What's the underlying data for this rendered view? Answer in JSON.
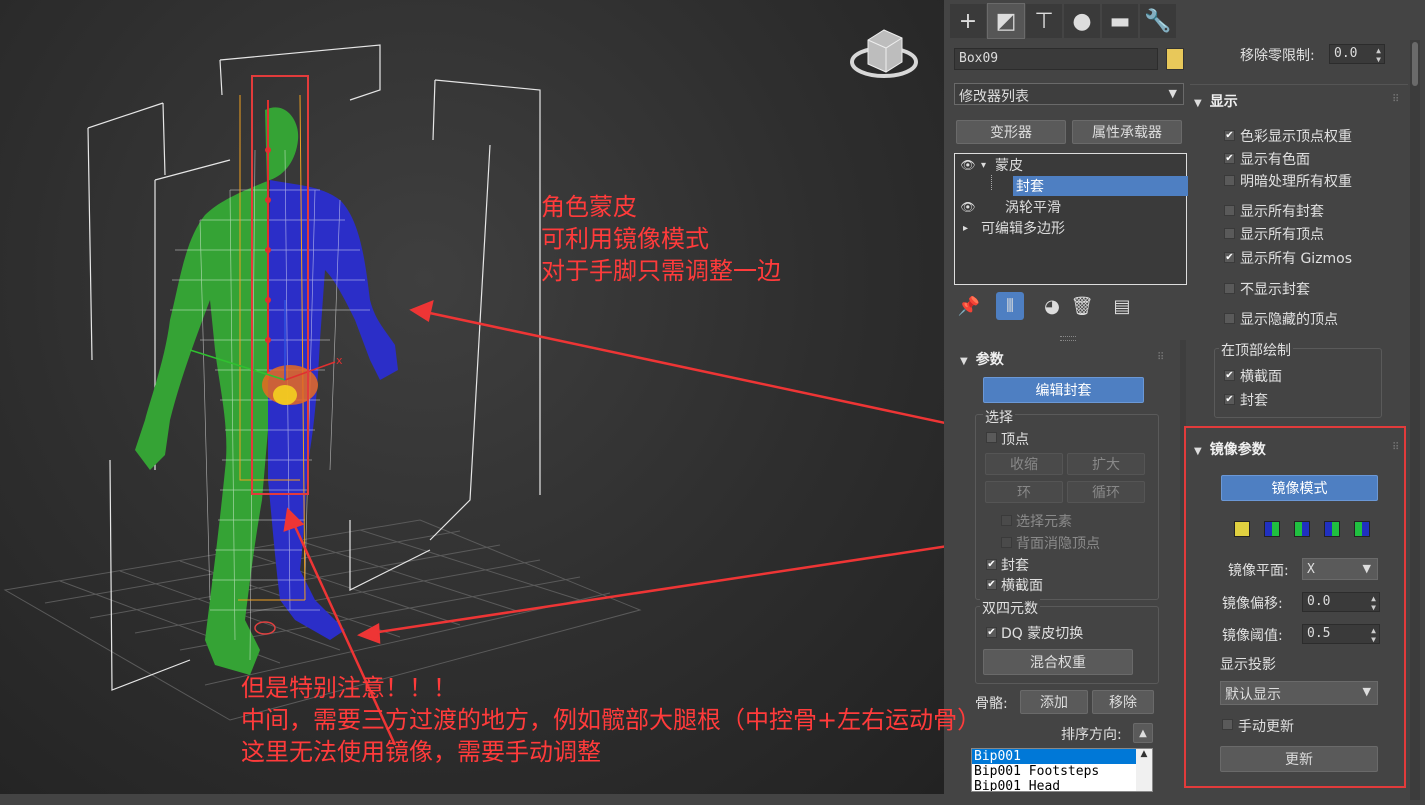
{
  "annotations": {
    "skin_lines": [
      "角色蒙皮",
      "可利用镜像模式",
      "对于手脚只需调整一边"
    ],
    "warning_lines": [
      "但是特别注意！！！",
      "中间，需要三方过渡的地方，例如髋部大腿根（中控骨+左右运动骨）",
      "这里无法使用镜像，需要手动调整"
    ]
  },
  "tabs": [
    {
      "icon": "create-icon",
      "glyph": "+"
    },
    {
      "icon": "modify-icon",
      "glyph": "◩"
    },
    {
      "icon": "hierarchy-icon",
      "glyph": "⊤"
    },
    {
      "icon": "motion-icon",
      "glyph": "●"
    },
    {
      "icon": "display-icon",
      "glyph": "▬"
    },
    {
      "icon": "utilities-icon",
      "glyph": "🔧"
    }
  ],
  "object": {
    "name": "Box09",
    "color": "#e8c85a"
  },
  "modifier_list": "修改器列表",
  "buttons": {
    "deformer": "变形器",
    "attr_holder": "属性承载器"
  },
  "stack": [
    {
      "label": "蒙皮",
      "indent": 0,
      "eye": true,
      "expand": "▾"
    },
    {
      "label": "封套",
      "indent": 1,
      "eye": false,
      "expand": "",
      "selected": true
    },
    {
      "label": "涡轮平滑",
      "indent": 0,
      "eye": true,
      "expand": ""
    },
    {
      "label": "可编辑多边形",
      "indent": 0,
      "eye": false,
      "expand": "▸"
    }
  ],
  "stack_tools": [
    "pin-icon",
    "show-end-result-icon",
    "make-unique-icon",
    "remove-modifier-icon",
    "configure-icon"
  ],
  "params": {
    "title": "参数",
    "edit_envelopes": "编辑封套",
    "select_group": "选择",
    "vertices": "顶点",
    "shrink": "收缩",
    "grow": "扩大",
    "ring": "环",
    "loop": "循环",
    "select_element": "选择元素",
    "backface_cull": "背面消隐顶点",
    "envelopes": "封套",
    "cross_sections": "横截面",
    "dq_group": "双四元数",
    "dq_toggle": "DQ 蒙皮切换",
    "blend_weights": "混合权重",
    "bones_label": "骨骼:",
    "add": "添加",
    "remove": "移除",
    "sort_label": "排序方向:",
    "bones": [
      "Bip001",
      "Bip001 Footsteps",
      "Bip001 Head"
    ]
  },
  "right": {
    "remove_zero_label": "移除零限制:",
    "remove_zero_value": "0.0",
    "display_title": "显示",
    "display_opts": [
      {
        "label": "色彩显示顶点权重",
        "checked": true
      },
      {
        "label": "显示有色面",
        "checked": true
      },
      {
        "label": "明暗处理所有权重",
        "checked": false
      },
      {
        "label": "显示所有封套",
        "checked": false
      },
      {
        "label": "显示所有顶点",
        "checked": false
      },
      {
        "label": "显示所有 Gizmos",
        "checked": true
      },
      {
        "label": "不显示封套",
        "checked": false
      },
      {
        "label": "显示隐藏的顶点",
        "checked": false
      }
    ],
    "draw_on_top": "在顶部绘制",
    "draw_opts": [
      {
        "label": "横截面",
        "checked": true
      },
      {
        "label": "封套",
        "checked": true
      }
    ],
    "mirror_title": "镜像参数",
    "mirror_mode": "镜像模式",
    "mirror_plane_label": "镜像平面:",
    "mirror_plane_value": "X",
    "mirror_offset_label": "镜像偏移:",
    "mirror_offset_value": "0.0",
    "mirror_threshold_label": "镜像阈值:",
    "mirror_threshold_value": "0.5",
    "display_proj_label": "显示投影",
    "display_proj_value": "默认显示",
    "manual_update": "手动更新",
    "update": "更新"
  }
}
